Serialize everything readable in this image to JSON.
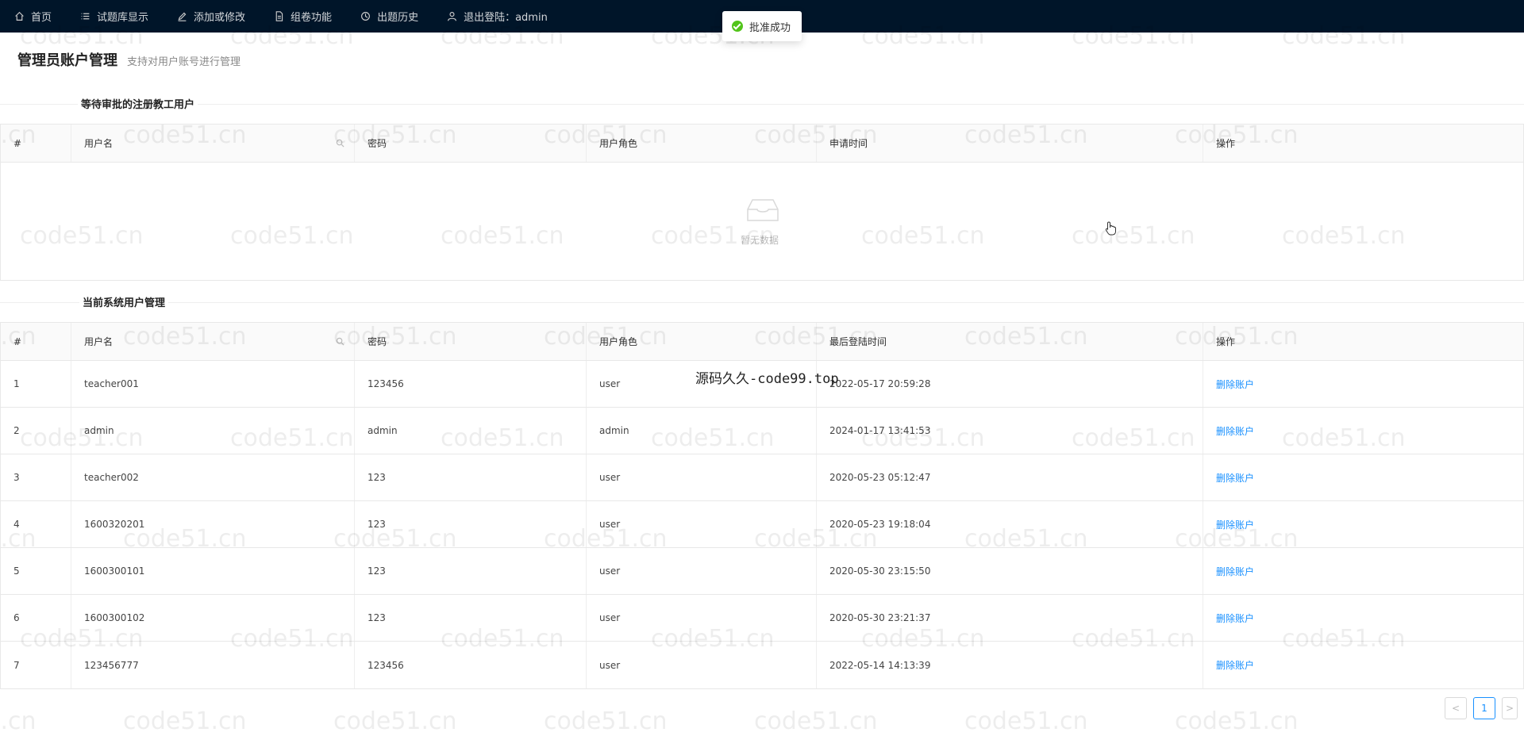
{
  "nav": {
    "items": [
      {
        "label": "首页",
        "icon": "home-icon"
      },
      {
        "label": "试题库显示",
        "icon": "list-icon"
      },
      {
        "label": "添加或修改",
        "icon": "edit-icon"
      },
      {
        "label": "组卷功能",
        "icon": "file-icon"
      },
      {
        "label": "出题历史",
        "icon": "history-icon"
      },
      {
        "label": "退出登陆：admin",
        "icon": "user-icon"
      }
    ]
  },
  "toast": {
    "message": "批准成功",
    "color": "#52c41a"
  },
  "header": {
    "title": "管理员账户管理",
    "subtitle": "支持对用户账号进行管理"
  },
  "pending": {
    "section_title": "等待审批的注册教工用户",
    "columns": [
      "#",
      "用户名",
      "密码",
      "用户角色",
      "申请时间",
      "操作"
    ],
    "empty_text": "暂无数据"
  },
  "users": {
    "section_title": "当前系统用户管理",
    "columns": [
      "#",
      "用户名",
      "密码",
      "用户角色",
      "最后登陆时间",
      "操作"
    ],
    "action_label": "删除账户",
    "rows": [
      {
        "idx": "1",
        "username": "teacher001",
        "password": "123456",
        "role": "user",
        "time": "2022-05-17 20:59:28"
      },
      {
        "idx": "2",
        "username": "admin",
        "password": "admin",
        "role": "admin",
        "time": "2024-01-17 13:41:53"
      },
      {
        "idx": "3",
        "username": "teacher002",
        "password": "123",
        "role": "user",
        "time": "2020-05-23 05:12:47"
      },
      {
        "idx": "4",
        "username": "1600320201",
        "password": "123",
        "role": "user",
        "time": "2020-05-23 19:18:04"
      },
      {
        "idx": "5",
        "username": "1600300101",
        "password": "123",
        "role": "user",
        "time": "2020-05-30 23:15:50"
      },
      {
        "idx": "6",
        "username": "1600300102",
        "password": "123",
        "role": "user",
        "time": "2020-05-30 23:21:37"
      },
      {
        "idx": "7",
        "username": "123456777",
        "password": "123456",
        "role": "user",
        "time": "2022-05-14 14:13:39"
      }
    ]
  },
  "pagination": {
    "current": "1",
    "prev": "<",
    "next": ">"
  },
  "watermark": {
    "text": "code51.cn",
    "overlay": "源码久久-code99.top"
  },
  "colors": {
    "nav_bg": "#001529",
    "link": "#1890ff"
  }
}
